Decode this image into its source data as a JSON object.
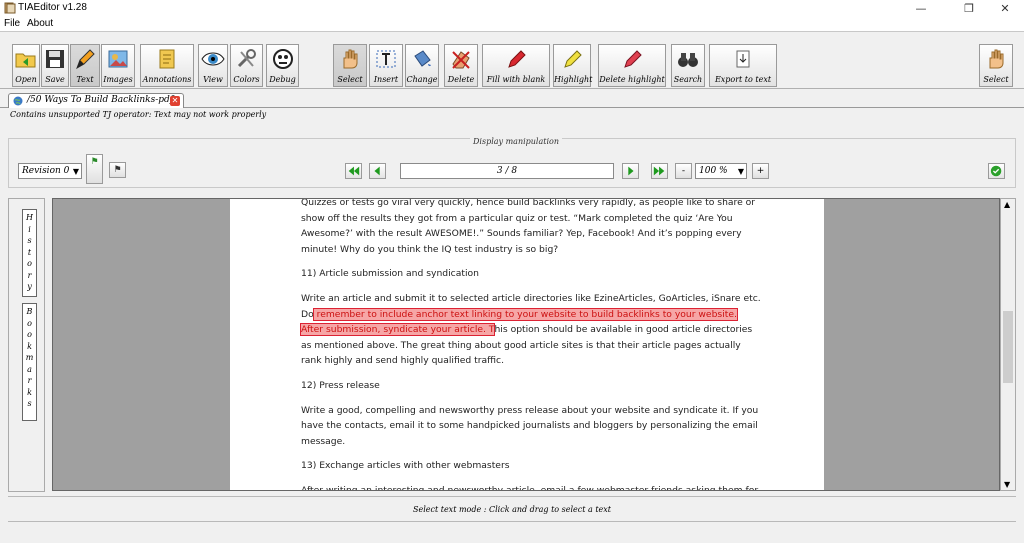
{
  "window": {
    "title": "TIAEditor v1.28",
    "controls": [
      "—",
      "❐",
      "✕"
    ]
  },
  "menu": {
    "file": "File",
    "about": "About"
  },
  "toolbar": {
    "left": [
      {
        "label": "Open",
        "icon": "open-folder-icon"
      },
      {
        "label": "Save",
        "icon": "floppy-disk-icon"
      },
      {
        "label": "Text",
        "icon": "pencil-icon"
      },
      {
        "label": "Images",
        "icon": "image-icon"
      },
      {
        "label": "Annotations",
        "icon": "note-icon"
      },
      {
        "label": "View",
        "icon": "eye-icon"
      },
      {
        "label": "Colors",
        "icon": "tools-icon"
      },
      {
        "label": "Debug",
        "icon": "bug-icon"
      }
    ],
    "mode": [
      {
        "label": "Select",
        "icon": "hand-icon"
      },
      {
        "label": "Insert",
        "icon": "insert-text-icon"
      },
      {
        "label": "Change",
        "icon": "paint-bucket-icon"
      },
      {
        "label": "Delete",
        "icon": "eraser-icon"
      },
      {
        "label": "Fill with blank",
        "icon": "marker-icon"
      },
      {
        "label": "Highlight",
        "icon": "highlighter-icon"
      },
      {
        "label": "Delete highlight",
        "icon": "delete-highlight-icon"
      },
      {
        "label": "Search",
        "icon": "binoculars-icon"
      },
      {
        "label": "Export to text",
        "icon": "export-text-icon"
      }
    ],
    "right": {
      "label": "Select",
      "icon": "hand-icon"
    }
  },
  "tab": {
    "label": "/50 Ways To Build Backlinks-pdf"
  },
  "warning": "Contains unsupported TJ operator: Text may not work properly",
  "display": {
    "group_label": "Display manipulation",
    "revision": "Revision 0",
    "page_indicator": "3 / 8",
    "zoom": "100 %",
    "minus": "-",
    "plus": "+"
  },
  "sidebar": {
    "history": [
      "H",
      "i",
      "s",
      "t",
      "o",
      "r",
      "y"
    ],
    "bookmarks": [
      "B",
      "o",
      "o",
      "k",
      "m",
      "a",
      "r",
      "k",
      "s"
    ]
  },
  "document": {
    "p0": "Quizzes or tests go viral very quickly, hence build backlinks very rapidly, as people like to share or show off the results they got from a particular quiz or test. “Mark completed the quiz ‘Are You Awesome?’ with the result AWESOME!.” Sounds familiar? Yep, Facebook! And it’s popping every minute! Why do you think the IQ test industry is so big?",
    "h11": "11) Article submission and syndication",
    "p11a": "Write an article and submit it to selected article directories like EzineArticles, GoArticles, iSnare etc. Do",
    "p11hl": " remember to include anchor text linking to your website to build backlinks to your website. After submission, syndicate your article. T",
    "p11b": "his option should be available in good article directories as mentioned above. The great thing about good article sites is that their article pages actually rank highly and send highly qualified traffic.",
    "h12": "12) Press release",
    "p12": "Write a good, compelling and newsworthy press release about your website and syndicate it. If you have the contacts, email it to some handpicked journalists and bloggers by personalizing the email message.",
    "h13": "13) Exchange articles with other webmasters",
    "p13": "After writing an interesting and newsworthy article, email a few webmaster friends asking them for"
  },
  "status": "Select text mode : Click and drag to select a text",
  "colors": {
    "highlight_fill": "#f6a6a6",
    "highlight_border": "#dd2222",
    "nav_green": "#1e9a1e"
  }
}
